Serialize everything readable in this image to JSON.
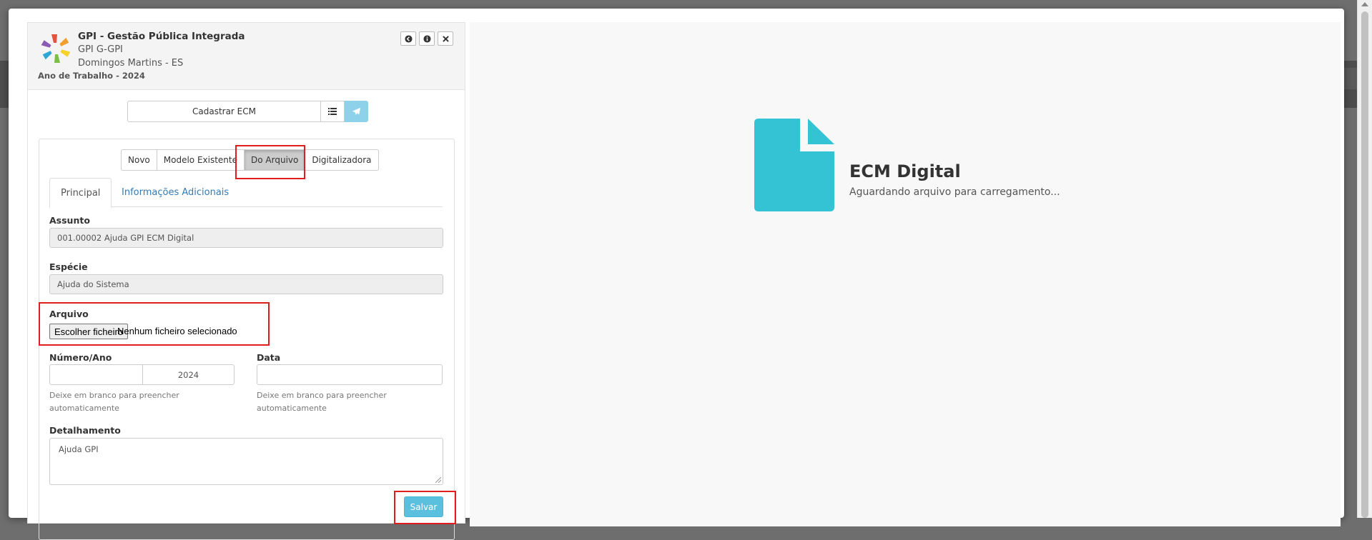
{
  "header": {
    "title": "GPI - Gestão Pública Integrada",
    "subtitle1": "GPI G-GPI",
    "subtitle2": "Domingos Martins - ES",
    "year": "Ano de Trabalho - 2024",
    "buttons": [
      "arrow-circle-left-icon",
      "info-circle-icon",
      "close-icon"
    ]
  },
  "toolbar": {
    "main_label": "Cadastrar ECM",
    "list_icon": "list-icon",
    "send_icon": "paper-plane-icon"
  },
  "source_options": [
    {
      "label": "Novo",
      "active": false
    },
    {
      "label": "Modelo Existente",
      "active": false
    },
    {
      "label": "Do Arquivo",
      "active": true
    },
    {
      "label": "Digitalizadora",
      "active": false
    }
  ],
  "tabs": [
    {
      "label": "Principal",
      "active": true
    },
    {
      "label": "Informações Adicionais",
      "active": false
    }
  ],
  "form": {
    "assunto_label": "Assunto",
    "assunto_value": "001.00002 Ajuda GPI ECM Digital",
    "especie_label": "Espécie",
    "especie_value": "Ajuda do Sistema",
    "arquivo_label": "Arquivo",
    "file_button": "Escolher ficheiro",
    "file_status": "Nenhum ficheiro selecionado",
    "numero_label": "Número/Ano",
    "numero_value": "",
    "ano_value": "2024",
    "numero_help": "Deixe em branco para preencher automaticamente",
    "data_label": "Data",
    "data_value": "",
    "data_help": "Deixe em branco para preencher automaticamente",
    "detalhamento_label": "Detalhamento",
    "detalhamento_value": "Ajuda GPI",
    "save_label": "Salvar"
  },
  "preview": {
    "title": "ECM Digital",
    "subtitle": "Aguardando arquivo para carregamento...",
    "icon": "file-icon",
    "icon_color": "#33c3d4"
  },
  "colors": {
    "highlight": "#e01e1e",
    "save_button": "#5bc0de",
    "link": "#337ab7"
  }
}
